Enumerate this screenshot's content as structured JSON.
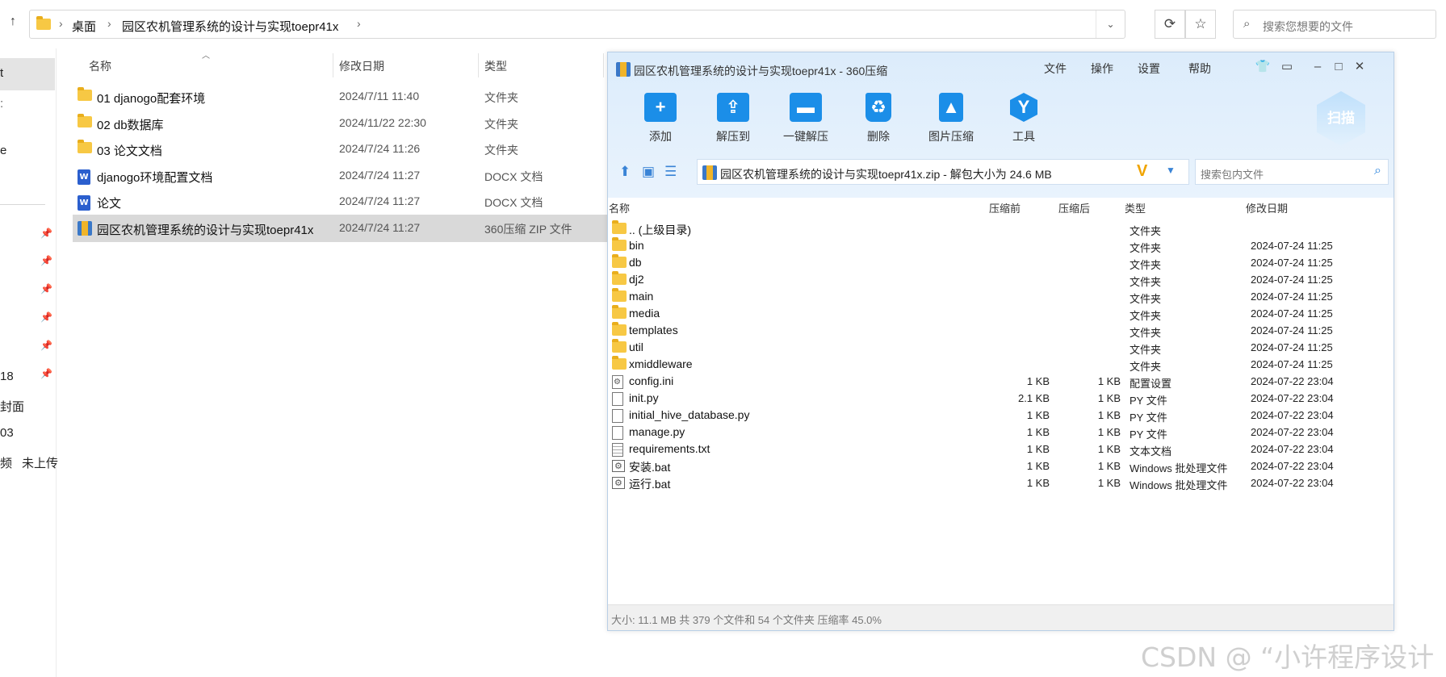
{
  "explorer": {
    "breadcrumb": [
      "桌面",
      "园区农机管理系统的设计与实现toepr41x"
    ],
    "search_placeholder": "搜索您想要的文件",
    "nav_fragments": [
      "t",
      "e",
      "18",
      "封面",
      "03",
      "频",
      "未上传"
    ],
    "columns": {
      "name": "名称",
      "date": "修改日期",
      "type": "类型"
    },
    "files": [
      {
        "icon": "folder",
        "name": "01 djanogo配套环境",
        "date": "2024/7/11 11:40",
        "type": "文件夹"
      },
      {
        "icon": "folder",
        "name": "02 db数据库",
        "date": "2024/11/22 22:30",
        "type": "文件夹"
      },
      {
        "icon": "folder",
        "name": "03 论文文档",
        "date": "2024/7/24 11:26",
        "type": "文件夹"
      },
      {
        "icon": "word",
        "name": "djanogo环境配置文档",
        "date": "2024/7/24 11:27",
        "type": "DOCX 文档"
      },
      {
        "icon": "word",
        "name": "论文",
        "date": "2024/7/24 11:27",
        "type": "DOCX 文档"
      },
      {
        "icon": "zip",
        "name": "园区农机管理系统的设计与实现toepr41x",
        "date": "2024/7/24 11:27",
        "type": "360压缩 ZIP 文件",
        "selected": true
      }
    ]
  },
  "zip": {
    "title": "园区农机管理系统的设计与实现toepr41x - 360压缩",
    "menu": [
      "文件",
      "操作",
      "设置",
      "帮助"
    ],
    "toolbar": [
      {
        "label": "添加",
        "icon": "plus-icon"
      },
      {
        "label": "解压到",
        "icon": "extract-icon"
      },
      {
        "label": "一键解压",
        "icon": "one-click-extract-icon"
      },
      {
        "label": "删除",
        "icon": "trash-icon"
      },
      {
        "label": "图片压缩",
        "icon": "image-compress-icon"
      },
      {
        "label": "工具",
        "icon": "tools-icon"
      }
    ],
    "scan_label": "扫描",
    "path": "园区农机管理系统的设计与实现toepr41x.zip - 解包大小为 24.6 MB",
    "search_placeholder": "搜索包内文件",
    "columns": {
      "name": "名称",
      "before": "压缩前",
      "after": "压缩后",
      "type": "类型",
      "date": "修改日期"
    },
    "rows": [
      {
        "icon": "folder",
        "name": ".. (上级目录)",
        "before": "",
        "after": "",
        "type": "文件夹",
        "date": ""
      },
      {
        "icon": "folder",
        "name": "bin",
        "before": "",
        "after": "",
        "type": "文件夹",
        "date": "2024-07-24 11:25"
      },
      {
        "icon": "folder",
        "name": "db",
        "before": "",
        "after": "",
        "type": "文件夹",
        "date": "2024-07-24 11:25"
      },
      {
        "icon": "folder",
        "name": "dj2",
        "before": "",
        "after": "",
        "type": "文件夹",
        "date": "2024-07-24 11:25"
      },
      {
        "icon": "folder",
        "name": "main",
        "before": "",
        "after": "",
        "type": "文件夹",
        "date": "2024-07-24 11:25"
      },
      {
        "icon": "folder",
        "name": "media",
        "before": "",
        "after": "",
        "type": "文件夹",
        "date": "2024-07-24 11:25"
      },
      {
        "icon": "folder",
        "name": "templates",
        "before": "",
        "after": "",
        "type": "文件夹",
        "date": "2024-07-24 11:25"
      },
      {
        "icon": "folder",
        "name": "util",
        "before": "",
        "after": "",
        "type": "文件夹",
        "date": "2024-07-24 11:25"
      },
      {
        "icon": "folder",
        "name": "xmiddleware",
        "before": "",
        "after": "",
        "type": "文件夹",
        "date": "2024-07-24 11:25"
      },
      {
        "icon": "ini",
        "name": "config.ini",
        "before": "1 KB",
        "after": "1 KB",
        "type": "配置设置",
        "date": "2024-07-22 23:04"
      },
      {
        "icon": "file",
        "name": "init.py",
        "before": "2.1 KB",
        "after": "1 KB",
        "type": "PY 文件",
        "date": "2024-07-22 23:04"
      },
      {
        "icon": "file",
        "name": "initial_hive_database.py",
        "before": "1 KB",
        "after": "1 KB",
        "type": "PY 文件",
        "date": "2024-07-22 23:04"
      },
      {
        "icon": "file",
        "name": "manage.py",
        "before": "1 KB",
        "after": "1 KB",
        "type": "PY 文件",
        "date": "2024-07-22 23:04"
      },
      {
        "icon": "txt",
        "name": "requirements.txt",
        "before": "1 KB",
        "after": "1 KB",
        "type": "文本文档",
        "date": "2024-07-22 23:04"
      },
      {
        "icon": "bat",
        "name": "安装.bat",
        "before": "1 KB",
        "after": "1 KB",
        "type": "Windows 批处理文件",
        "date": "2024-07-22 23:04"
      },
      {
        "icon": "bat",
        "name": "运行.bat",
        "before": "1 KB",
        "after": "1 KB",
        "type": "Windows 批处理文件",
        "date": "2024-07-22 23:04"
      }
    ],
    "status": "大小: 11.1 MB 共 379 个文件和 54 个文件夹 压缩率 45.0%"
  },
  "watermark": "CSDN @ “小许程序设计"
}
